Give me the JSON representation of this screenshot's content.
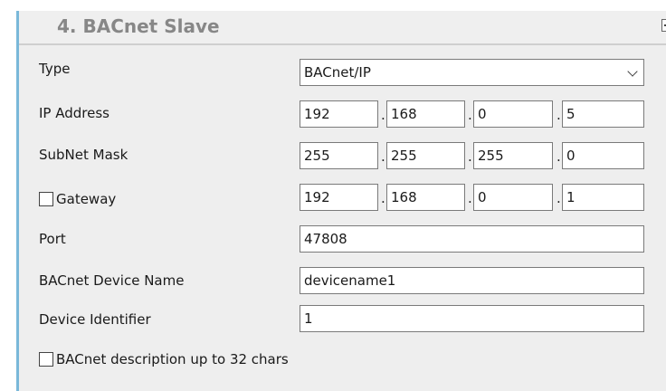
{
  "panel": {
    "title": "4. BACnet Slave"
  },
  "type": {
    "label": "Type",
    "selected": "BACnet/IP"
  },
  "ip_address": {
    "label": "IP Address",
    "octets": [
      "192",
      "168",
      "0",
      "5"
    ]
  },
  "subnet_mask": {
    "label": "SubNet Mask",
    "octets": [
      "255",
      "255",
      "255",
      "0"
    ]
  },
  "gateway": {
    "label": "Gateway",
    "checked": false,
    "octets": [
      "192",
      "168",
      "0",
      "1"
    ]
  },
  "port": {
    "label": "Port",
    "value": "47808"
  },
  "device_name": {
    "label": "BACnet Device Name",
    "value": "devicename1"
  },
  "device_identifier": {
    "label": "Device Identifier",
    "value": "1"
  },
  "description_option": {
    "label": "BACnet description up to 32 chars",
    "checked": false
  }
}
